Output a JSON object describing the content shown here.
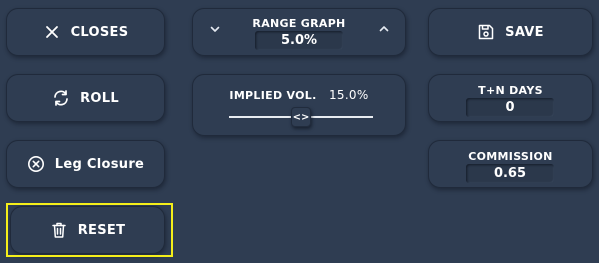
{
  "left": {
    "closes_label": "CLOSES",
    "roll_label": "ROLL",
    "leg_closure_label": "Leg Closure",
    "reset_label": "RESET"
  },
  "range_graph": {
    "title": "RANGE GRAPH",
    "value": "5.0%"
  },
  "implied_vol": {
    "title": "IMPLIED VOL.",
    "value": "15.0%",
    "handle_glyph": "<>"
  },
  "right": {
    "save_label": "SAVE",
    "tn_days_title": "T+N DAYS",
    "tn_days_value": "0",
    "commission_title": "COMMISSION",
    "commission_value": "0.65"
  },
  "icons": {
    "closes": "close-icon",
    "roll": "refresh-icon",
    "leg_closure": "circle-x-icon",
    "reset": "trash-icon",
    "save": "floppy-disk-icon",
    "decrease": "chevron-down-icon",
    "increase": "chevron-up-icon"
  },
  "colors": {
    "background": "#2f3d52",
    "text": "#ffffff",
    "highlight": "#f5ef1a"
  }
}
